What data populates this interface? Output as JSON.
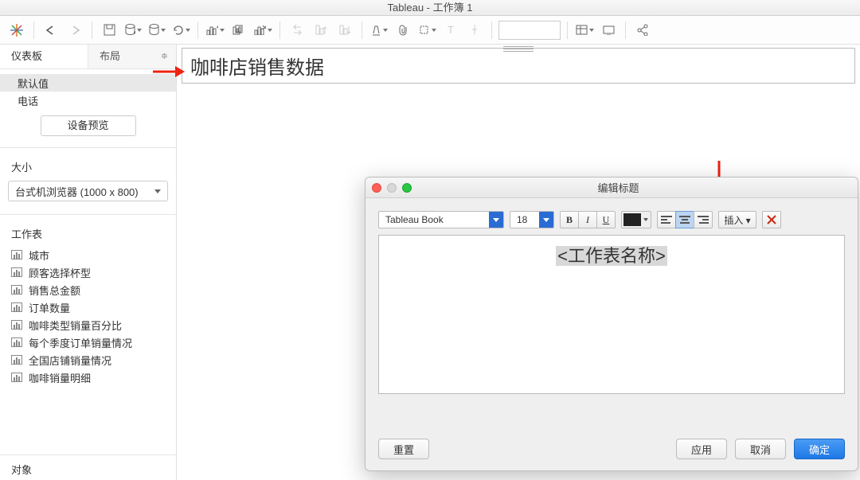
{
  "app": {
    "title": "Tableau - 工作簿 1"
  },
  "sidebar": {
    "tabs": {
      "dashboard": "仪表板",
      "layout": "布局"
    },
    "defaults": {
      "default": "默认值",
      "phone": "电话"
    },
    "device_preview_btn": "设备预览",
    "size": {
      "header": "大小",
      "value": "台式机浏览器 (1000 x 800)"
    },
    "sheets": {
      "header": "工作表",
      "items": [
        "城市",
        "顾客选择杯型",
        "销售总金额",
        "订单数量",
        "咖啡类型销量百分比",
        "每个季度订单销量情况",
        "全国店铺销量情况",
        "咖啡销量明细"
      ]
    },
    "objects_header": "对象"
  },
  "dashboard": {
    "title": "咖啡店销售数据"
  },
  "modal": {
    "title": "编辑标题",
    "font": "Tableau Book",
    "size": "18",
    "insert": "插入 ▾",
    "placeholder": "<工作表名称>",
    "buttons": {
      "reset": "重置",
      "apply": "应用",
      "cancel": "取消",
      "ok": "确定"
    }
  }
}
